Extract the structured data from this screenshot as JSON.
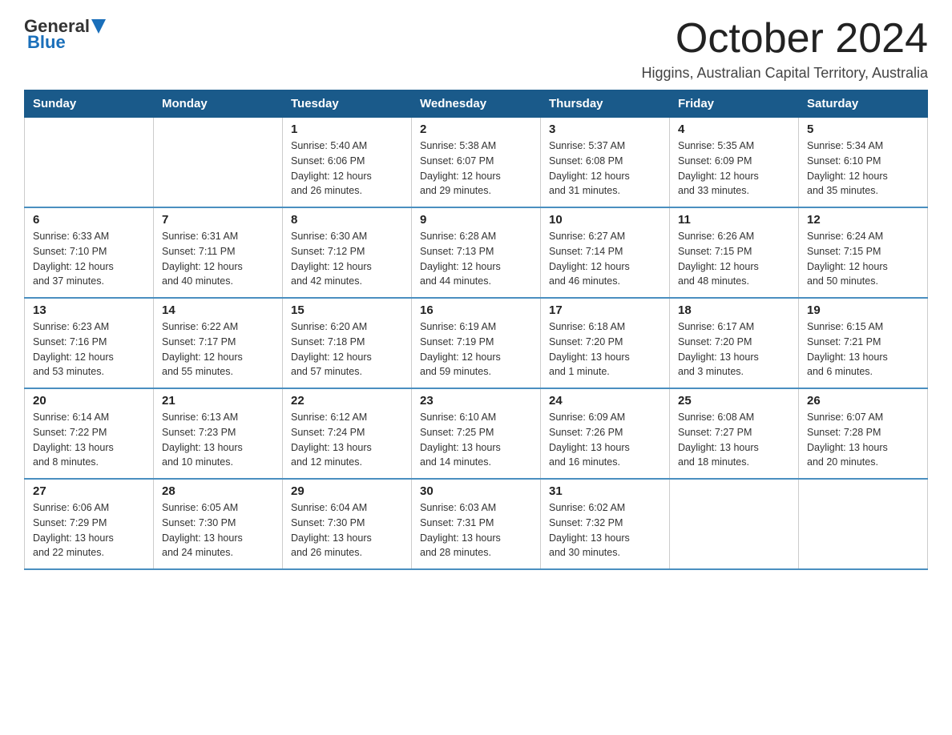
{
  "logo": {
    "general": "General",
    "blue": "Blue"
  },
  "header": {
    "month": "October 2024",
    "location": "Higgins, Australian Capital Territory, Australia"
  },
  "weekdays": [
    "Sunday",
    "Monday",
    "Tuesday",
    "Wednesday",
    "Thursday",
    "Friday",
    "Saturday"
  ],
  "weeks": [
    [
      {
        "day": "",
        "info": ""
      },
      {
        "day": "",
        "info": ""
      },
      {
        "day": "1",
        "info": "Sunrise: 5:40 AM\nSunset: 6:06 PM\nDaylight: 12 hours\nand 26 minutes."
      },
      {
        "day": "2",
        "info": "Sunrise: 5:38 AM\nSunset: 6:07 PM\nDaylight: 12 hours\nand 29 minutes."
      },
      {
        "day": "3",
        "info": "Sunrise: 5:37 AM\nSunset: 6:08 PM\nDaylight: 12 hours\nand 31 minutes."
      },
      {
        "day": "4",
        "info": "Sunrise: 5:35 AM\nSunset: 6:09 PM\nDaylight: 12 hours\nand 33 minutes."
      },
      {
        "day": "5",
        "info": "Sunrise: 5:34 AM\nSunset: 6:10 PM\nDaylight: 12 hours\nand 35 minutes."
      }
    ],
    [
      {
        "day": "6",
        "info": "Sunrise: 6:33 AM\nSunset: 7:10 PM\nDaylight: 12 hours\nand 37 minutes."
      },
      {
        "day": "7",
        "info": "Sunrise: 6:31 AM\nSunset: 7:11 PM\nDaylight: 12 hours\nand 40 minutes."
      },
      {
        "day": "8",
        "info": "Sunrise: 6:30 AM\nSunset: 7:12 PM\nDaylight: 12 hours\nand 42 minutes."
      },
      {
        "day": "9",
        "info": "Sunrise: 6:28 AM\nSunset: 7:13 PM\nDaylight: 12 hours\nand 44 minutes."
      },
      {
        "day": "10",
        "info": "Sunrise: 6:27 AM\nSunset: 7:14 PM\nDaylight: 12 hours\nand 46 minutes."
      },
      {
        "day": "11",
        "info": "Sunrise: 6:26 AM\nSunset: 7:15 PM\nDaylight: 12 hours\nand 48 minutes."
      },
      {
        "day": "12",
        "info": "Sunrise: 6:24 AM\nSunset: 7:15 PM\nDaylight: 12 hours\nand 50 minutes."
      }
    ],
    [
      {
        "day": "13",
        "info": "Sunrise: 6:23 AM\nSunset: 7:16 PM\nDaylight: 12 hours\nand 53 minutes."
      },
      {
        "day": "14",
        "info": "Sunrise: 6:22 AM\nSunset: 7:17 PM\nDaylight: 12 hours\nand 55 minutes."
      },
      {
        "day": "15",
        "info": "Sunrise: 6:20 AM\nSunset: 7:18 PM\nDaylight: 12 hours\nand 57 minutes."
      },
      {
        "day": "16",
        "info": "Sunrise: 6:19 AM\nSunset: 7:19 PM\nDaylight: 12 hours\nand 59 minutes."
      },
      {
        "day": "17",
        "info": "Sunrise: 6:18 AM\nSunset: 7:20 PM\nDaylight: 13 hours\nand 1 minute."
      },
      {
        "day": "18",
        "info": "Sunrise: 6:17 AM\nSunset: 7:20 PM\nDaylight: 13 hours\nand 3 minutes."
      },
      {
        "day": "19",
        "info": "Sunrise: 6:15 AM\nSunset: 7:21 PM\nDaylight: 13 hours\nand 6 minutes."
      }
    ],
    [
      {
        "day": "20",
        "info": "Sunrise: 6:14 AM\nSunset: 7:22 PM\nDaylight: 13 hours\nand 8 minutes."
      },
      {
        "day": "21",
        "info": "Sunrise: 6:13 AM\nSunset: 7:23 PM\nDaylight: 13 hours\nand 10 minutes."
      },
      {
        "day": "22",
        "info": "Sunrise: 6:12 AM\nSunset: 7:24 PM\nDaylight: 13 hours\nand 12 minutes."
      },
      {
        "day": "23",
        "info": "Sunrise: 6:10 AM\nSunset: 7:25 PM\nDaylight: 13 hours\nand 14 minutes."
      },
      {
        "day": "24",
        "info": "Sunrise: 6:09 AM\nSunset: 7:26 PM\nDaylight: 13 hours\nand 16 minutes."
      },
      {
        "day": "25",
        "info": "Sunrise: 6:08 AM\nSunset: 7:27 PM\nDaylight: 13 hours\nand 18 minutes."
      },
      {
        "day": "26",
        "info": "Sunrise: 6:07 AM\nSunset: 7:28 PM\nDaylight: 13 hours\nand 20 minutes."
      }
    ],
    [
      {
        "day": "27",
        "info": "Sunrise: 6:06 AM\nSunset: 7:29 PM\nDaylight: 13 hours\nand 22 minutes."
      },
      {
        "day": "28",
        "info": "Sunrise: 6:05 AM\nSunset: 7:30 PM\nDaylight: 13 hours\nand 24 minutes."
      },
      {
        "day": "29",
        "info": "Sunrise: 6:04 AM\nSunset: 7:30 PM\nDaylight: 13 hours\nand 26 minutes."
      },
      {
        "day": "30",
        "info": "Sunrise: 6:03 AM\nSunset: 7:31 PM\nDaylight: 13 hours\nand 28 minutes."
      },
      {
        "day": "31",
        "info": "Sunrise: 6:02 AM\nSunset: 7:32 PM\nDaylight: 13 hours\nand 30 minutes."
      },
      {
        "day": "",
        "info": ""
      },
      {
        "day": "",
        "info": ""
      }
    ]
  ]
}
